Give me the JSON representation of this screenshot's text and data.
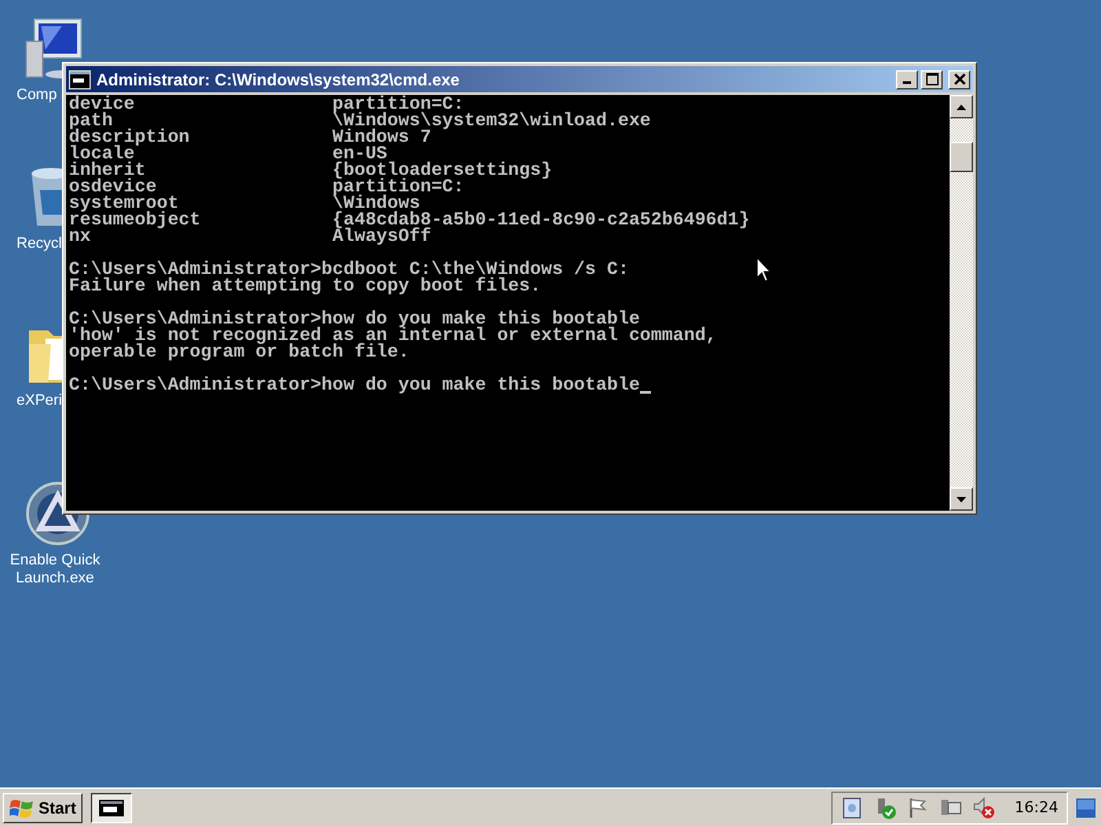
{
  "desktop_icons": [
    {
      "kind": "computer",
      "label": "Comp"
    },
    {
      "kind": "recycle",
      "label": "Recycl"
    },
    {
      "kind": "folder",
      "label": "eXPeri"
    },
    {
      "kind": "launcher",
      "label": "Enable Quick Launch.exe"
    }
  ],
  "window": {
    "title": "Administrator: C:\\Windows\\system32\\cmd.exe",
    "console": {
      "blocks": [
        {
          "lines": [
            "device                  partition=C:",
            "path                    \\Windows\\system32\\winload.exe",
            "description             Windows 7",
            "locale                  en-US",
            "inherit                 {bootloadersettings}",
            "osdevice                partition=C:",
            "systemroot              \\Windows",
            "resumeobject            {a48cdab8-a5b0-11ed-8c90-c2a52b6496d1}",
            "nx                      AlwaysOff"
          ]
        },
        {
          "lines": [
            "C:\\Users\\Administrator>bcdboot C:\\the\\Windows /s C:",
            "Failure when attempting to copy boot files."
          ]
        },
        {
          "lines": [
            "C:\\Users\\Administrator>how do you make this bootable",
            "'how' is not recognized as an internal or external command,",
            "operable program or batch file."
          ]
        },
        {
          "lines": [
            "C:\\Users\\Administrator>how do you make this bootable"
          ]
        }
      ],
      "cursor": true
    }
  },
  "taskbar": {
    "start": "Start",
    "clock": "16:24"
  }
}
